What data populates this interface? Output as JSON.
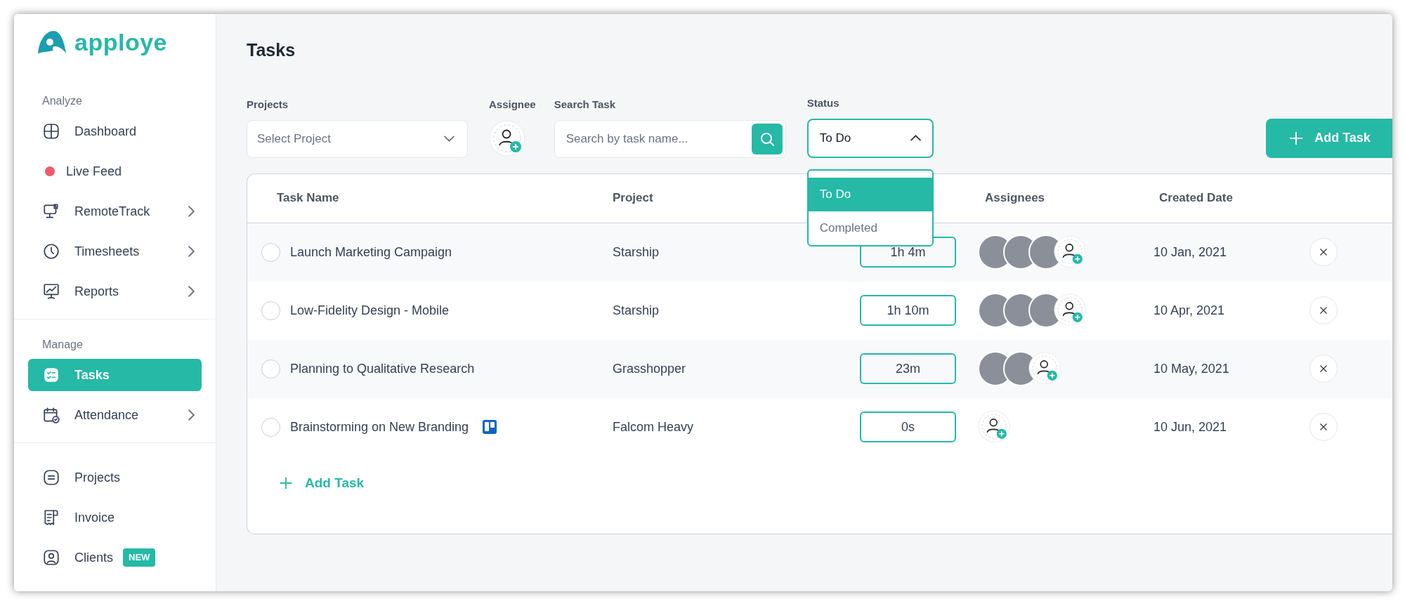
{
  "logo": {
    "text": "apploye"
  },
  "sidebar": {
    "sections": [
      {
        "title": "Analyze",
        "items": [
          {
            "label": "Dashboard",
            "kind": "grid",
            "expandable": false,
            "selected": false
          },
          {
            "label": "Live Feed",
            "kind": "dot",
            "color": "#f05b6b",
            "expandable": false,
            "selected": false
          },
          {
            "label": "RemoteTrack",
            "kind": "monitor",
            "expandable": true,
            "selected": false
          },
          {
            "label": "Timesheets",
            "kind": "clock",
            "expandable": true,
            "selected": false
          },
          {
            "label": "Reports",
            "kind": "chart",
            "expandable": true,
            "selected": false
          }
        ]
      },
      {
        "title": "Manage",
        "items": [
          {
            "label": "Tasks",
            "kind": "tasks",
            "expandable": false,
            "selected": true
          },
          {
            "label": "Attendance",
            "kind": "calendar",
            "expandable": true,
            "selected": false
          }
        ]
      },
      {
        "items": [
          {
            "label": "Projects",
            "kind": "projects",
            "expandable": false,
            "selected": false
          },
          {
            "label": "Invoice",
            "kind": "invoice",
            "expandable": false,
            "selected": false
          },
          {
            "label": "Clients",
            "kind": "client",
            "expandable": false,
            "selected": false,
            "badge": "NEW"
          }
        ]
      }
    ]
  },
  "title": "Tasks",
  "filters": {
    "projects": {
      "label": "Projects",
      "placeholder": "Select Project"
    },
    "assignee": {
      "label": "Assignee"
    },
    "search": {
      "label": "Search Task",
      "placeholder": "Search by task name..."
    },
    "status": {
      "label": "Status",
      "value": "To Do",
      "expanded": true,
      "options": [
        {
          "label": "To Do",
          "selected": true
        },
        {
          "label": "Completed",
          "selected": false
        }
      ]
    }
  },
  "add_task_button": "Add Task",
  "table": {
    "columns": {
      "task": "Task Name",
      "project": "Project",
      "assignees": "Assignees",
      "created": "Created Date"
    },
    "rows": [
      {
        "checked": false,
        "name": "Launch Marketing Campaign",
        "board_icon": false,
        "project": "Starship",
        "time": "1h 4m",
        "assignees": [
          {
            "kind": "photo"
          },
          {
            "kind": "photo"
          },
          {
            "kind": "photo"
          }
        ],
        "created": "10 Jan, 2021"
      },
      {
        "checked": false,
        "name": "Low-Fidelity Design - Mobile",
        "board_icon": false,
        "project": "Starship",
        "time": "1h 10m",
        "assignees": [
          {
            "kind": "photo"
          },
          {
            "kind": "photo"
          },
          {
            "kind": "photo"
          }
        ],
        "created": "10 Apr, 2021"
      },
      {
        "checked": false,
        "name": "Planning to Qualitative Research",
        "board_icon": false,
        "project": "Grasshopper",
        "time": "23m",
        "assignees": [
          {
            "kind": "photo"
          },
          {
            "kind": "photo"
          }
        ],
        "created": "10 May, 2021"
      },
      {
        "checked": false,
        "name": "Brainstorming on New Branding",
        "board_icon": true,
        "project": "Falcom Heavy",
        "time": "0s",
        "assignees": [],
        "created": "10 Jun, 2021"
      }
    ],
    "add_row": "Add Task"
  }
}
